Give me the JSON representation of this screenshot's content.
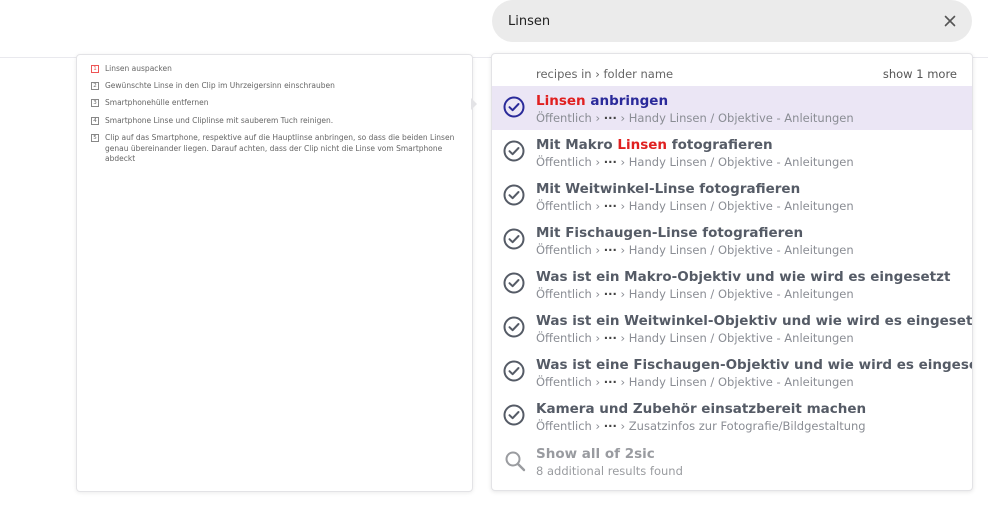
{
  "search": {
    "value": "Linsen",
    "clear_icon": "close-icon"
  },
  "preview": {
    "steps": [
      {
        "num": "1",
        "text": "Linsen auspacken"
      },
      {
        "num": "2",
        "text": "Gewünschte Linse in den Clip im Uhrzeigersinn einschrauben"
      },
      {
        "num": "3",
        "text": "Smartphonehülle entfernen"
      },
      {
        "num": "4",
        "text": "Smartphone Linse und Cliplinse mit sauberem Tuch reinigen."
      },
      {
        "num": "5",
        "text": "Clip auf das Smartphone, respektive auf die Hauptlinse anbringen, so dass die beiden Linsen genau übereinander liegen. Darauf achten, dass der Clip nicht die Linse vom Smartphone abdeckt"
      }
    ]
  },
  "results": {
    "header_left": "recipes in › folder name",
    "header_right": "show 1 more",
    "items": [
      {
        "pre": "",
        "hl": "Linsen",
        "post": " anbringen",
        "path_start": "Öffentlich ›",
        "path_dots": "···",
        "path_end": "› Handy Linsen / Objektive - Anleitungen"
      },
      {
        "pre": "Mit Makro ",
        "hl": "Linsen",
        "post": " fotografieren",
        "path_start": "Öffentlich ›",
        "path_dots": "···",
        "path_end": "› Handy Linsen / Objektive - Anleitungen"
      },
      {
        "pre": "Mit Weitwinkel-Linse fotografieren",
        "hl": "",
        "post": "",
        "path_start": "Öffentlich ›",
        "path_dots": "···",
        "path_end": "› Handy Linsen / Objektive - Anleitungen"
      },
      {
        "pre": "Mit Fischaugen-Linse fotografieren",
        "hl": "",
        "post": "",
        "path_start": "Öffentlich ›",
        "path_dots": "···",
        "path_end": "› Handy Linsen / Objektive - Anleitungen"
      },
      {
        "pre": "Was ist ein Makro-Objektiv und wie wird es eingesetzt",
        "hl": "",
        "post": "",
        "path_start": "Öffentlich ›",
        "path_dots": "···",
        "path_end": "› Handy Linsen / Objektive - Anleitungen"
      },
      {
        "pre": "Was ist ein Weitwinkel-Objektiv und wie wird es eingesetzt",
        "hl": "",
        "post": "",
        "path_start": "Öffentlich ›",
        "path_dots": "···",
        "path_end": "› Handy Linsen / Objektive - Anleitungen"
      },
      {
        "pre": "Was ist eine Fischaugen-Objektiv und wie wird es eingesetzt?",
        "hl": "",
        "post": "",
        "path_start": "Öffentlich ›",
        "path_dots": "···",
        "path_end": "› Handy Linsen / Objektive - Anleitungen"
      },
      {
        "pre": "Kamera und Zubehör einsatzbereit machen",
        "hl": "",
        "post": "",
        "path_start": "Öffentlich ›",
        "path_dots": "···",
        "path_end": "› Zusatzinfos zur Fotografie/Bildgestaltung"
      }
    ],
    "show_all_title": "Show all of 2sic",
    "show_all_sub": "8 additional results found"
  },
  "colors": {
    "active_bg": "#ebe6f5",
    "highlight": "#e02020",
    "active_title": "#2a2a9a",
    "search_bg": "#ebebeb"
  }
}
